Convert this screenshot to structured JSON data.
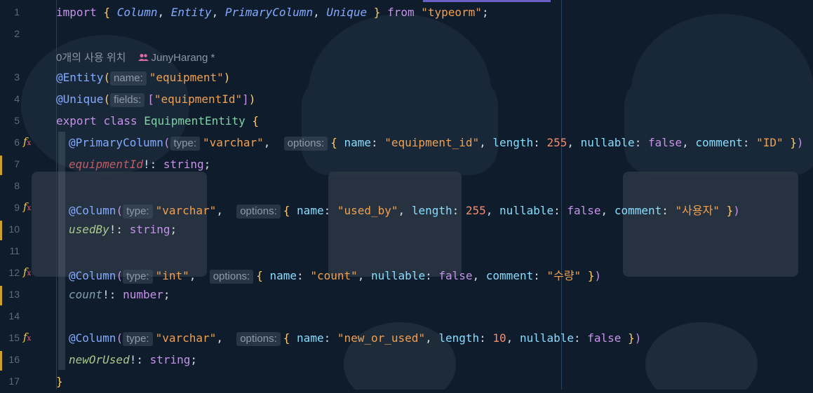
{
  "editor": {
    "code_lens": {
      "usages": "0개의 사용 위치",
      "author": "JunyHarang *"
    },
    "lines": [
      {
        "n": "1"
      },
      {
        "n": "2"
      },
      {
        "n": "3"
      },
      {
        "n": "4"
      },
      {
        "n": "5"
      },
      {
        "n": "6"
      },
      {
        "n": "7"
      },
      {
        "n": "8"
      },
      {
        "n": "9"
      },
      {
        "n": "10"
      },
      {
        "n": "11"
      },
      {
        "n": "12"
      },
      {
        "n": "13"
      },
      {
        "n": "14"
      },
      {
        "n": "15"
      },
      {
        "n": "16"
      },
      {
        "n": "17"
      }
    ],
    "tokens": {
      "import": "import",
      "from": "from",
      "module": "\"typeorm\"",
      "imports": [
        "Column",
        "Entity",
        "PrimaryColumn",
        "Unique"
      ],
      "entity_deco": "@Entity",
      "unique_deco": "@Unique",
      "primary_deco": "@PrimaryColumn",
      "column_deco": "@Column",
      "export": "export",
      "class": "class",
      "class_name": "EquipmentEntity",
      "hint_name": "name:",
      "hint_fields": "fields:",
      "hint_type": "type:",
      "hint_options": "options:",
      "entity_name": "\"equipment\"",
      "unique_field": "\"equipmentId\"",
      "t_varchar": "\"varchar\"",
      "t_int": "\"int\"",
      "k_name": "name",
      "k_length": "length",
      "k_nullable": "nullable",
      "k_comment": "comment",
      "v_false": "false",
      "v_255": "255",
      "v_10": "10",
      "col_equipment_id": "\"equipment_id\"",
      "cmt_id": "\"ID\"",
      "col_used_by": "\"used_by\"",
      "cmt_user": "\"사용자\"",
      "col_count": "\"count\"",
      "cmt_qty": "\"수량\"",
      "col_new_or_used": "\"new_or_used\"",
      "f_equipmentId": "equipmentId",
      "f_usedBy": "usedBy",
      "f_count": "count",
      "f_newOrUsed": "newOrUsed",
      "t_string": "string",
      "t_number": "number"
    }
  },
  "colors": {
    "background": "#0f1c2b",
    "keyword": "#c792ea",
    "string": "#f0a050",
    "git_modified": "#c9a227"
  }
}
